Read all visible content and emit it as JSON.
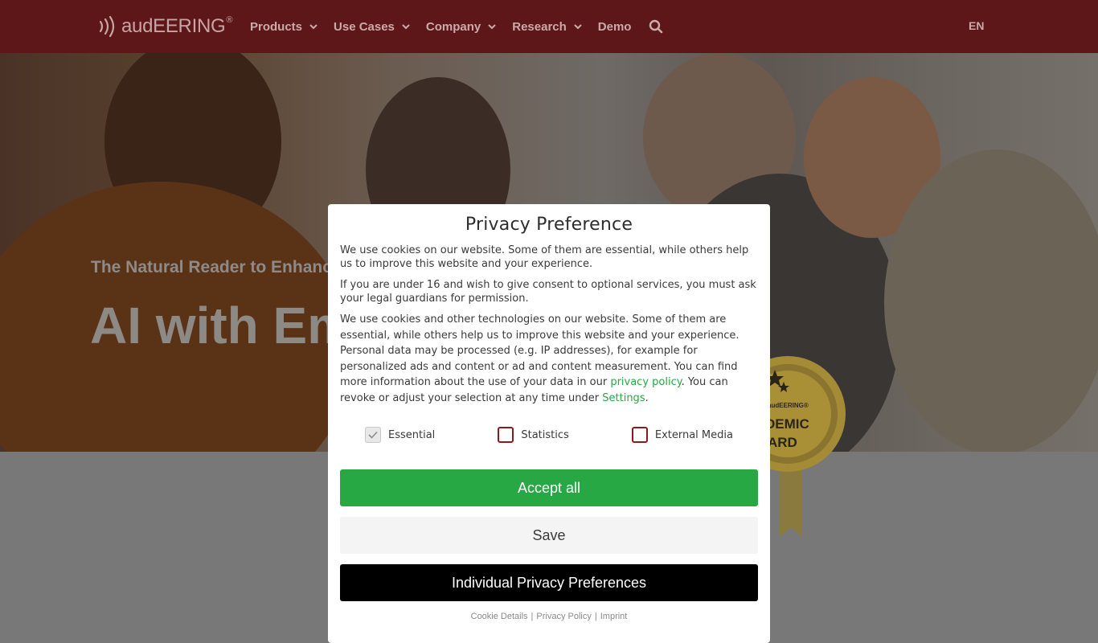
{
  "header": {
    "logo_text": "audEERING",
    "logo_reg": "®",
    "nav": [
      {
        "label": "Products",
        "has_dropdown": true
      },
      {
        "label": "Use Cases",
        "has_dropdown": true
      },
      {
        "label": "Company",
        "has_dropdown": true
      },
      {
        "label": "Research",
        "has_dropdown": true
      },
      {
        "label": "Demo",
        "has_dropdown": false
      }
    ],
    "search_icon": "search-icon",
    "language": "EN"
  },
  "hero": {
    "tagline": "The Natural Reader to Enhance",
    "heading": "AI with Em",
    "award_line1": "audEERING®",
    "award_line2": "DEMIC",
    "award_line3": "ARD"
  },
  "modal": {
    "title": "Privacy Preference",
    "para1": "We use cookies on our website. Some of them are essential, while others help us to improve this website and your experience.",
    "para2": "If you are under 16 and wish to give consent to optional services, you must ask your legal guardians for permission.",
    "para3_before": "We use cookies and other technologies on our website. Some of them are essential, while others help us to improve this website and your experience. Personal data may be processed (e.g. IP addresses), for example for personalized ads and content or ad and content measurement. You can find more information about the use of your data in our ",
    "privacy_link": "privacy policy",
    "para3_middle": ". You can revoke or adjust your selection at any time under ",
    "settings_link": "Settings",
    "para3_after": ".",
    "checkboxes": [
      {
        "label": "Essential",
        "checked": true,
        "disabled": true
      },
      {
        "label": "Statistics",
        "checked": false,
        "disabled": false
      },
      {
        "label": "External Media",
        "checked": false,
        "disabled": false
      }
    ],
    "accept_label": "Accept all",
    "save_label": "Save",
    "individual_label": "Individual Privacy Preferences",
    "footer_links": [
      "Cookie Details",
      "Privacy Policy",
      "Imprint"
    ],
    "footer_separator": "|"
  },
  "colors": {
    "header_bg": "#5d1718",
    "accent_green": "#28a745",
    "checkbox_border": "#8b1a1a"
  }
}
